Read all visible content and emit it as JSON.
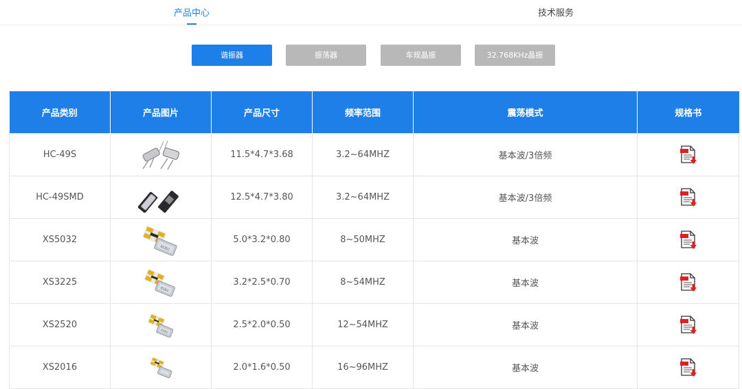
{
  "tabs": [
    {
      "label": "产品中心",
      "active": true
    },
    {
      "label": "技术服务",
      "active": false
    }
  ],
  "filters": [
    {
      "label": "谐振器",
      "active": true
    },
    {
      "label": "振荡器",
      "active": false
    },
    {
      "label": "车规晶振",
      "active": false
    },
    {
      "label": "32.768KHz晶振",
      "active": false
    }
  ],
  "table": {
    "headers": [
      "产品类别",
      "产品图片",
      "产品尺寸",
      "频率范围",
      "震荡模式",
      "规格书"
    ],
    "rows": [
      {
        "category": "HC-49S",
        "image": "hc49s-crystal-image",
        "size": "11.5*4.7*3.68",
        "freq": "3.2~64MHZ",
        "mode": "基本波/3倍频"
      },
      {
        "category": "HC-49SMD",
        "image": "hc49smd-crystal-image",
        "size": "12.5*4.7*3.80",
        "freq": "3.2~64MHZ",
        "mode": "基本波/3倍频"
      },
      {
        "category": "XS5032",
        "image": "smd-crystal-image",
        "size": "5.0*3.2*0.80",
        "freq": "8~50MHZ",
        "mode": "基本波"
      },
      {
        "category": "XS3225",
        "image": "smd-crystal-image",
        "size": "3.2*2.5*0.70",
        "freq": "8~54MHZ",
        "mode": "基本波"
      },
      {
        "category": "XS2520",
        "image": "smd-crystal-image",
        "size": "2.5*2.0*0.50",
        "freq": "12~54MHZ",
        "mode": "基本波"
      },
      {
        "category": "XS2016",
        "image": "smd-crystal-image",
        "size": "2.0*1.6*0.50",
        "freq": "16~96MHZ",
        "mode": "基本波"
      }
    ],
    "spec_icon": "pdf-download-icon"
  },
  "colors": {
    "accent": "#1f7fe8",
    "inactive_button": "#b8b8b8",
    "pdf_red": "#e02020"
  }
}
